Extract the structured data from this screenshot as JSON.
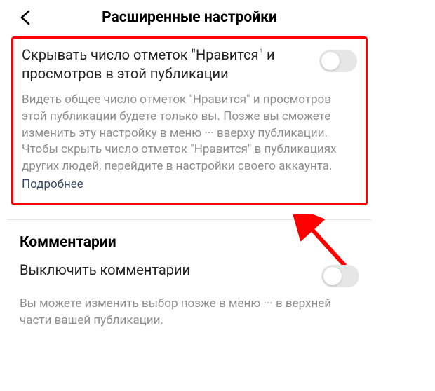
{
  "header": {
    "title": "Расширенные настройки"
  },
  "likes_section": {
    "toggle_label": "Скрывать число отметок \"Нравится\" и просмотров в этой публикации",
    "description": "Видеть общее число отметок \"Нравится\" и просмотров этой публикации будете только вы. Позже вы сможете изменить эту настройку в меню ··· вверху публикации. Чтобы скрыть число отметок \"Нравится\" в публикациях других людей, перейдите в настройки своего аккаунта.",
    "learn_more": "Подробнее",
    "toggle_state": "off"
  },
  "comments_section": {
    "heading": "Комментарии",
    "toggle_label": "Выключить комментарии",
    "description": "Вы можете изменить выбор позже в меню ··· в верхней части вашей публикации.",
    "toggle_state": "off"
  },
  "annotation": {
    "highlight_color": "#ff0000",
    "arrow_color": "#ff0000"
  }
}
